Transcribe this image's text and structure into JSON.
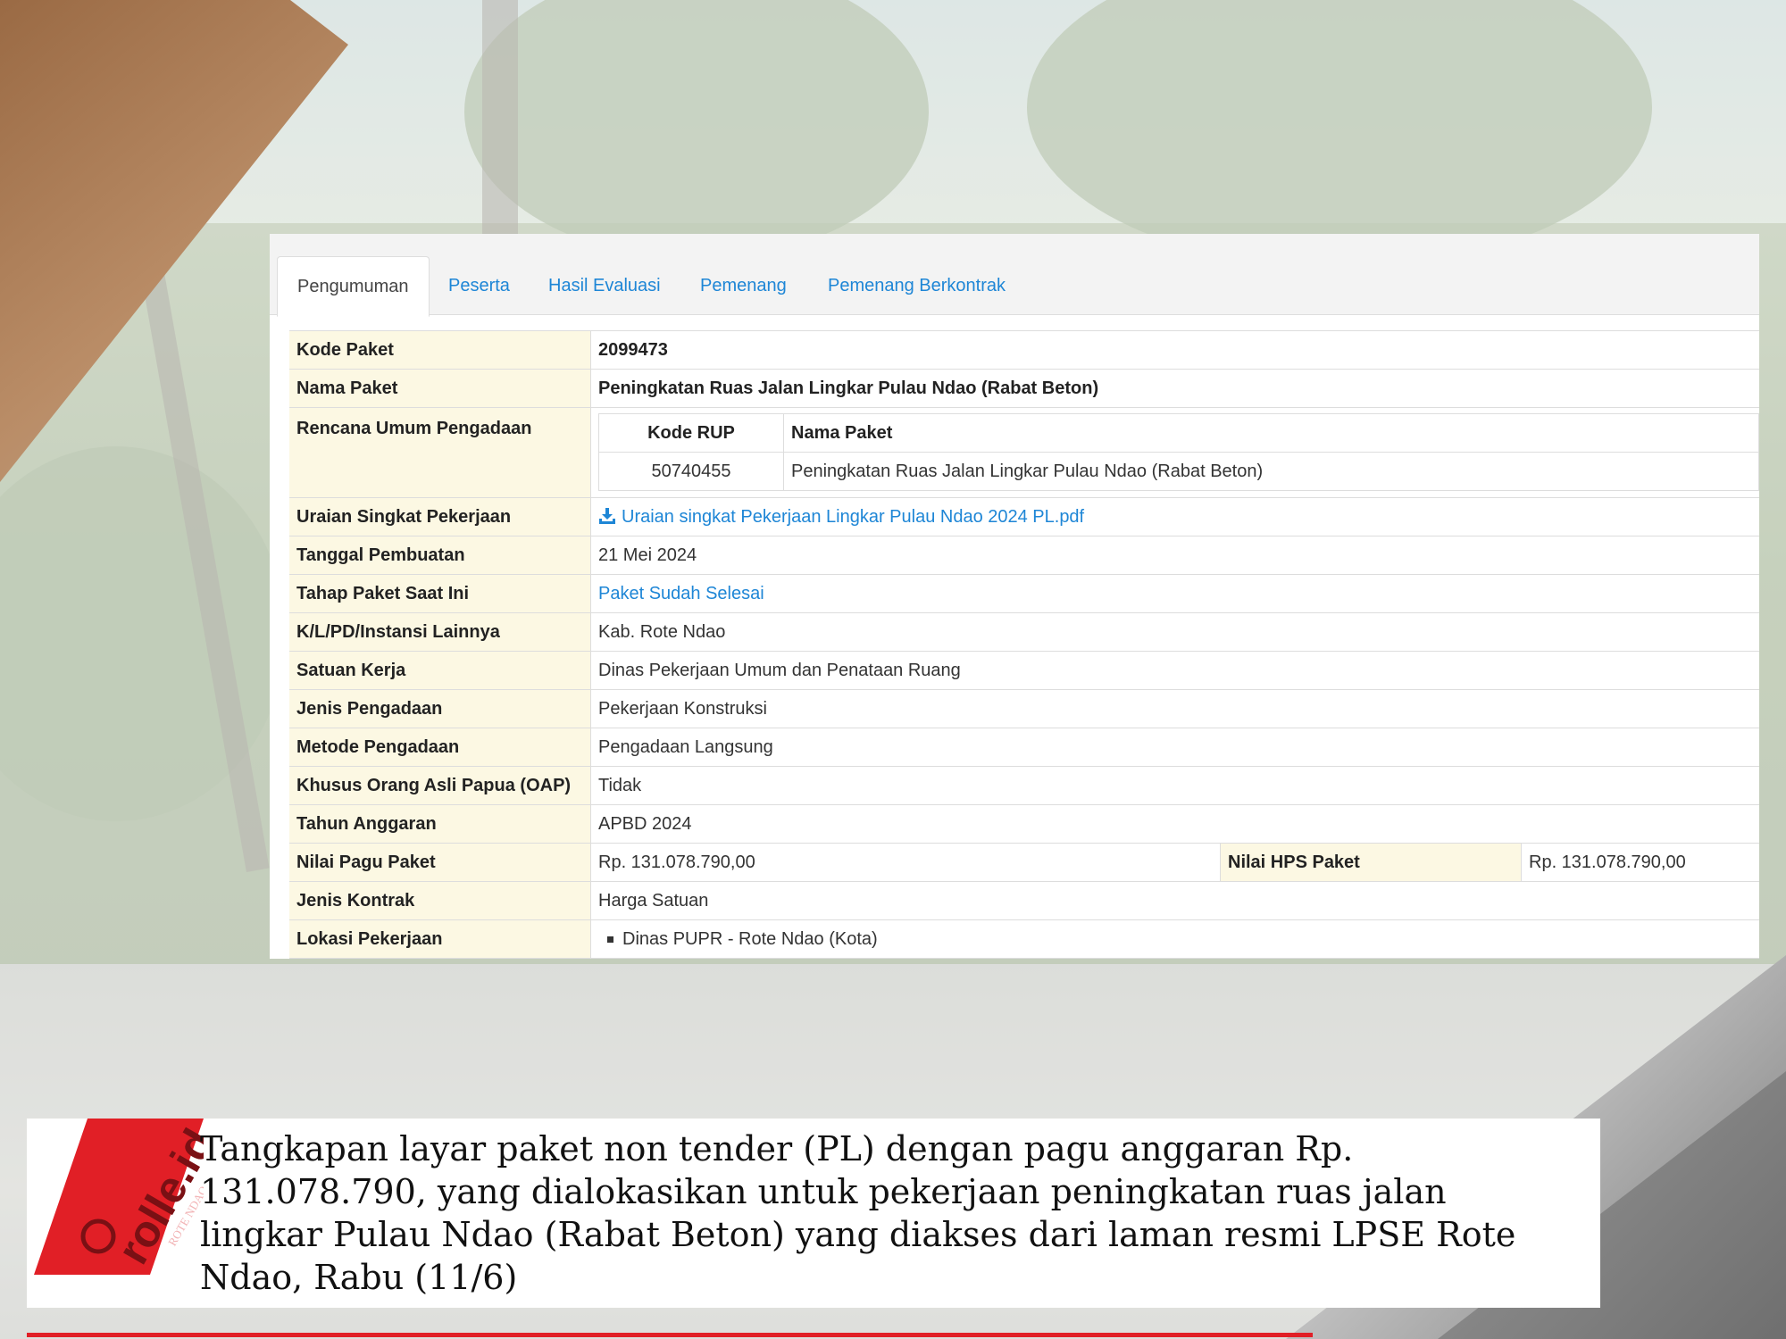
{
  "tabs": [
    {
      "label": "Pengumuman",
      "active": true
    },
    {
      "label": "Peserta"
    },
    {
      "label": "Hasil Evaluasi"
    },
    {
      "label": "Pemenang"
    },
    {
      "label": "Pemenang Berkontrak"
    }
  ],
  "detail": {
    "kode_paket": {
      "label": "Kode Paket",
      "value": "2099473"
    },
    "nama_paket": {
      "label": "Nama Paket",
      "value": "Peningkatan Ruas Jalan Lingkar Pulau Ndao (Rabat Beton)"
    },
    "rup": {
      "label": "Rencana Umum Pengadaan",
      "col_kode": "Kode RUP",
      "col_nama": "Nama Paket",
      "kode": "50740455",
      "nama": "Peningkatan Ruas Jalan Lingkar Pulau Ndao (Rabat Beton)"
    },
    "uraian": {
      "label": "Uraian Singkat Pekerjaan",
      "file": "Uraian singkat Pekerjaan Lingkar Pulau Ndao 2024 PL.pdf",
      "icon": "download-icon"
    },
    "tanggal": {
      "label": "Tanggal Pembuatan",
      "value": "21 Mei 2024"
    },
    "tahap": {
      "label": "Tahap Paket Saat Ini",
      "value": "Paket Sudah Selesai"
    },
    "klpd": {
      "label": "K/L/PD/Instansi Lainnya",
      "value": "Kab. Rote Ndao"
    },
    "satker": {
      "label": "Satuan Kerja",
      "value": "Dinas Pekerjaan Umum dan Penataan Ruang"
    },
    "jenis_pengadaan": {
      "label": "Jenis Pengadaan",
      "value": "Pekerjaan Konstruksi"
    },
    "metode": {
      "label": "Metode Pengadaan",
      "value": "Pengadaan Langsung"
    },
    "oap": {
      "label": "Khusus Orang Asli Papua (OAP)",
      "value": "Tidak"
    },
    "tahun": {
      "label": "Tahun Anggaran",
      "value": "APBD 2024"
    },
    "pagu": {
      "label": "Nilai Pagu Paket",
      "value": "Rp. 131.078.790,00"
    },
    "hps": {
      "label": "Nilai HPS Paket",
      "value": "Rp. 131.078.790,00"
    },
    "kontrak": {
      "label": "Jenis Kontrak",
      "value": "Harga Satuan"
    },
    "lokasi": {
      "label": "Lokasi Pekerjaan",
      "value": "Dinas PUPR - Rote Ndao (Kota)"
    }
  },
  "caption": {
    "logo_text": "rolle.id",
    "logo_sub": "ROTE NDAO",
    "text": "Tangkapan layar paket non tender (PL) dengan pagu anggaran Rp. 131.078.790, yang dialokasikan untuk pekerjaan peningkatan ruas jalan lingkar Pulau Ndao (Rabat Beton) yang diakses dari laman resmi LPSE Rote Ndao, Rabu (11/6)"
  },
  "colors": {
    "link": "#1e86d6",
    "label_bg": "#fcf8e3",
    "brand_red": "#e11f26"
  }
}
